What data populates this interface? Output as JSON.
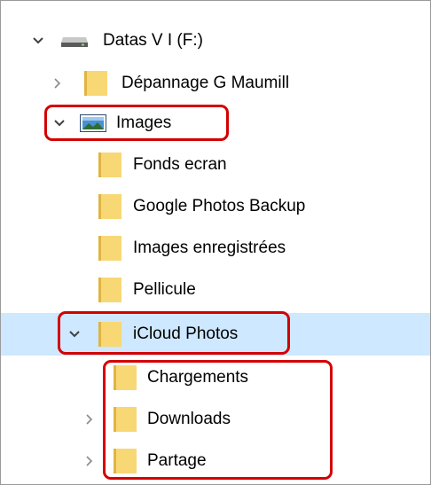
{
  "tree": {
    "items": [
      {
        "label": "Datas V I (F:)",
        "expand": "expanded",
        "icon": "drive-icon",
        "depth": 0
      },
      {
        "label": "Dépannage G Maumill",
        "expand": "collapsed",
        "icon": "folder-icon",
        "depth": 1
      },
      {
        "label": "Images",
        "expand": "expanded",
        "icon": "pictures-library-icon",
        "depth": 0
      },
      {
        "label": "Fonds ecran",
        "expand": "none",
        "icon": "folder-icon",
        "depth": 2
      },
      {
        "label": "Google Photos Backup",
        "expand": "none",
        "icon": "folder-icon",
        "depth": 2
      },
      {
        "label": "Images enregistrées",
        "expand": "none",
        "icon": "folder-icon",
        "depth": 2
      },
      {
        "label": "Pellicule",
        "expand": "none",
        "icon": "folder-icon",
        "depth": 2
      },
      {
        "label": "iCloud Photos",
        "expand": "expanded",
        "icon": "folder-icon",
        "depth": 1,
        "selected": true
      },
      {
        "label": "Chargements",
        "expand": "none",
        "icon": "folder-icon",
        "depth": 3
      },
      {
        "label": "Downloads",
        "expand": "collapsed",
        "icon": "folder-icon",
        "depth": 3
      },
      {
        "label": "Partage",
        "expand": "collapsed",
        "icon": "folder-icon",
        "depth": 3
      }
    ]
  },
  "colors": {
    "selection": "#cde8ff",
    "highlight": "#d40000",
    "folder": "#f8d775",
    "chevron": "#404040"
  }
}
